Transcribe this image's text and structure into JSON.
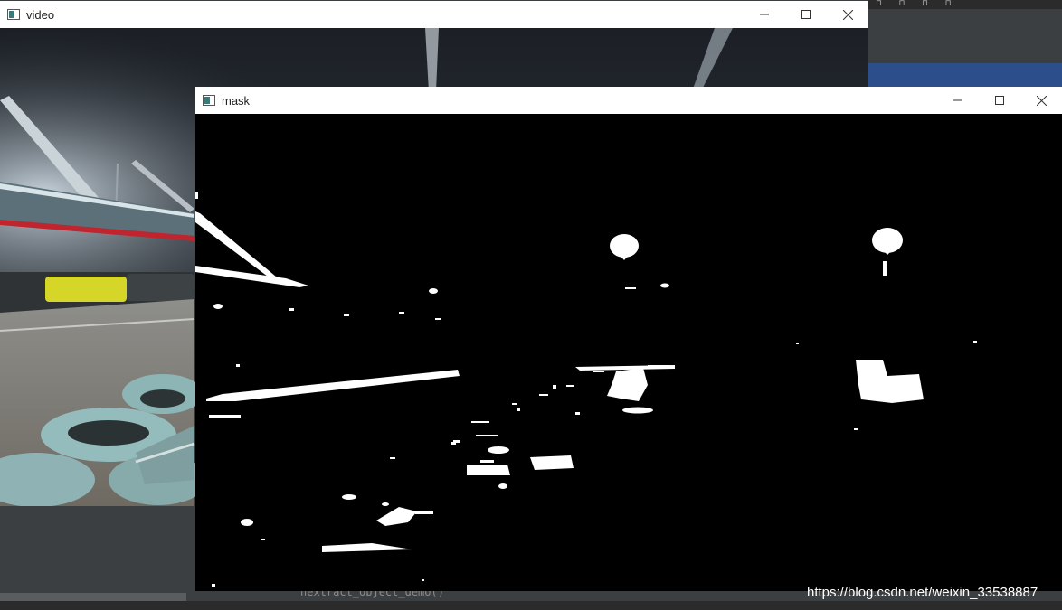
{
  "windows": {
    "video": {
      "title": "video"
    },
    "mask": {
      "title": "mask"
    }
  },
  "controls": {
    "minimize_icon": "minimize-icon",
    "maximize_icon": "maximize-icon",
    "close_icon": "close-icon"
  },
  "ide": {
    "code_snippet": "nextract_object_demo()"
  },
  "watermark": "https://blog.csdn.net/weixin_33538887",
  "colors": {
    "titlebar": "#ffffff",
    "mask_background": "#000000",
    "mask_foreground": "#ffffff",
    "ide_background": "#3c3f41",
    "ide_accent": "#2c4f8c"
  }
}
